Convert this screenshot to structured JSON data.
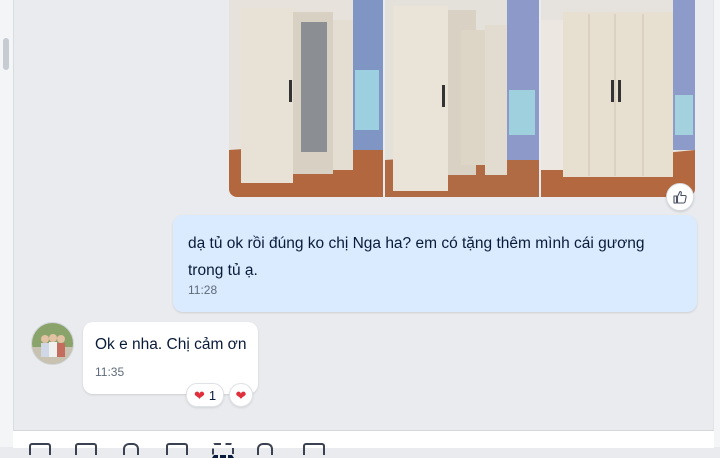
{
  "outgoing_message": {
    "text": "dạ tủ ok rồi đúng ko chị Nga ha? em có tặng thêm mình cái gương trong tủ ạ.",
    "time": "11:28"
  },
  "incoming_message": {
    "text": "Ok e nha. Chị cảm ơn",
    "time": "11:35",
    "reaction": {
      "emoji": "heart",
      "count": "1"
    }
  },
  "photo_strip": {
    "photos": [
      "wardrobe-photo-1",
      "wardrobe-photo-2",
      "wardrobe-photo-3"
    ]
  },
  "icons": {
    "like": "thumbs-up-icon",
    "reaction": "heart-icon",
    "composer_tools": [
      "sticker-icon",
      "image-icon",
      "attach-icon",
      "card-icon",
      "screenshot-icon",
      "text-format-icon",
      "more-icon"
    ]
  },
  "colors": {
    "background": "#e9ebee",
    "outgoing_bubble": "#dbebff",
    "incoming_bubble": "#ffffff",
    "heart": "#e0303b"
  }
}
